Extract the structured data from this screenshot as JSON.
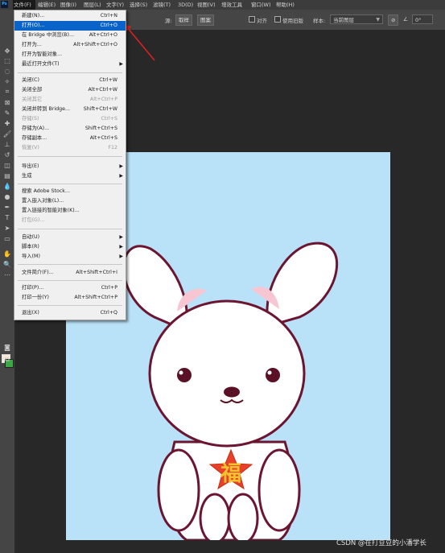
{
  "app": {
    "logo": "Ps"
  },
  "menubar": {
    "items": [
      "文件(F)",
      "编辑(E)",
      "图像(I)",
      "图层(L)",
      "文字(Y)",
      "选择(S)",
      "滤镜(T)",
      "3D(D)",
      "视图(V)",
      "增效工具",
      "窗口(W)",
      "帮助(H)"
    ]
  },
  "options_bar": {
    "source_label": "源:",
    "normal_button": "取样",
    "pattern_button": "图案",
    "align_label": "对齐",
    "use_legacy_label": "使用旧版",
    "sample_label": "样本:",
    "sample_value": "当前图层",
    "angle_value": "0°"
  },
  "file_menu": {
    "items": [
      {
        "label": "新建(N)...",
        "shortcut": "Ctrl+N"
      },
      {
        "label": "打开(O)...",
        "shortcut": "Ctrl+O",
        "highlighted": true
      },
      {
        "label": "在 Bridge 中浏览(B)...",
        "shortcut": "Alt+Ctrl+O"
      },
      {
        "label": "打开为...",
        "shortcut": "Alt+Shift+Ctrl+O"
      },
      {
        "label": "打开为智能对象...",
        "shortcut": ""
      },
      {
        "label": "最近打开文件(T)",
        "shortcut": "",
        "submenu": true
      },
      {
        "label": "关闭(C)",
        "shortcut": "Ctrl+W"
      },
      {
        "label": "关闭全部",
        "shortcut": "Alt+Ctrl+W"
      },
      {
        "label": "关闭其它",
        "shortcut": "Alt+Ctrl+P",
        "disabled": true
      },
      {
        "label": "关闭并转到 Bridge...",
        "shortcut": "Shift+Ctrl+W"
      },
      {
        "label": "存储(S)",
        "shortcut": "Ctrl+S",
        "disabled": true
      },
      {
        "label": "存储为(A)...",
        "shortcut": "Shift+Ctrl+S"
      },
      {
        "label": "存储副本...",
        "shortcut": "Alt+Ctrl+S"
      },
      {
        "label": "恢复(V)",
        "shortcut": "F12",
        "disabled": true
      },
      {
        "label": "导出(E)",
        "shortcut": "",
        "submenu": true
      },
      {
        "label": "生成",
        "shortcut": "",
        "submenu": true
      },
      {
        "label": "搜索 Adobe Stock...",
        "shortcut": ""
      },
      {
        "label": "置入嵌入对象(L)...",
        "shortcut": ""
      },
      {
        "label": "置入链接的智能对象(K)...",
        "shortcut": ""
      },
      {
        "label": "打包(G)...",
        "shortcut": "",
        "disabled": true
      },
      {
        "label": "自动(U)",
        "shortcut": "",
        "submenu": true
      },
      {
        "label": "脚本(R)",
        "shortcut": "",
        "submenu": true
      },
      {
        "label": "导入(M)",
        "shortcut": "",
        "submenu": true
      },
      {
        "label": "文件简介(F)...",
        "shortcut": "Alt+Shift+Ctrl+I"
      },
      {
        "label": "打印(P)...",
        "shortcut": "Ctrl+P"
      },
      {
        "label": "打印一份(Y)",
        "shortcut": "Alt+Shift+Ctrl+P"
      },
      {
        "label": "退出(X)",
        "shortcut": "Ctrl+Q"
      }
    ]
  },
  "canvas": {
    "badge_text": "福"
  },
  "watermark": "CSDN @在打豆豆的小潘学长",
  "colors": {
    "highlight": "#0a63c9",
    "canvas_bg": "#b9e1f8",
    "outline": "#6b1530",
    "star": "#e8402a",
    "fu": "#f2c12e"
  }
}
